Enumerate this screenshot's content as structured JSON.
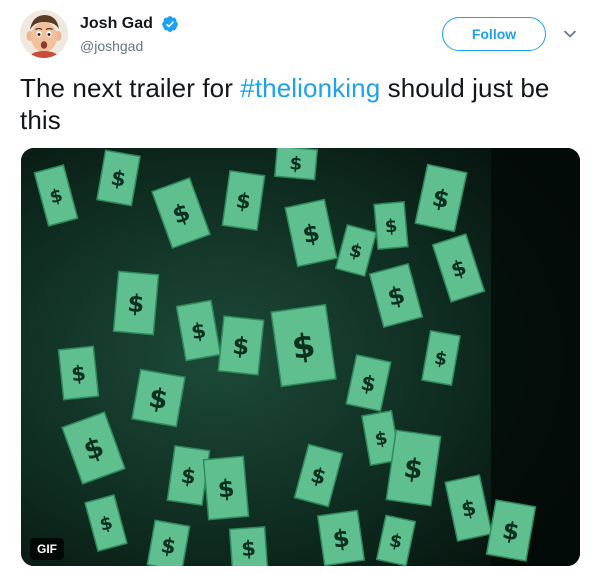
{
  "author": {
    "display_name": "Josh Gad",
    "handle": "@joshgad",
    "verified": true
  },
  "actions": {
    "follow_label": "Follow",
    "menu_icon": "chevron-down-icon"
  },
  "tweet": {
    "text_before": "The next trailer for ",
    "hashtag": "#thelionking",
    "text_after": " should just be this"
  },
  "media": {
    "type": "gif",
    "badge": "GIF",
    "description_icon": "money-rain"
  },
  "colors": {
    "link": "#1da1f2",
    "text": "#14171a",
    "secondary": "#657786",
    "bill": "#5fbf8f",
    "bill_dark": "#2f8a5e",
    "background": "#0f2a1f"
  }
}
